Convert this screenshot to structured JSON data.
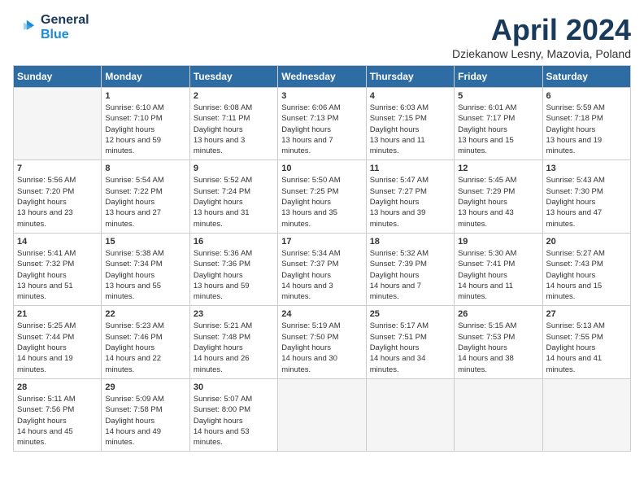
{
  "header": {
    "logo_line1": "General",
    "logo_line2": "Blue",
    "month_title": "April 2024",
    "location": "Dziekanow Lesny, Mazovia, Poland"
  },
  "weekdays": [
    "Sunday",
    "Monday",
    "Tuesday",
    "Wednesday",
    "Thursday",
    "Friday",
    "Saturday"
  ],
  "weeks": [
    [
      {
        "day": "",
        "empty": true
      },
      {
        "day": "1",
        "sunrise": "6:10 AM",
        "sunset": "7:10 PM",
        "daylight": "12 hours and 59 minutes."
      },
      {
        "day": "2",
        "sunrise": "6:08 AM",
        "sunset": "7:11 PM",
        "daylight": "13 hours and 3 minutes."
      },
      {
        "day": "3",
        "sunrise": "6:06 AM",
        "sunset": "7:13 PM",
        "daylight": "13 hours and 7 minutes."
      },
      {
        "day": "4",
        "sunrise": "6:03 AM",
        "sunset": "7:15 PM",
        "daylight": "13 hours and 11 minutes."
      },
      {
        "day": "5",
        "sunrise": "6:01 AM",
        "sunset": "7:17 PM",
        "daylight": "13 hours and 15 minutes."
      },
      {
        "day": "6",
        "sunrise": "5:59 AM",
        "sunset": "7:18 PM",
        "daylight": "13 hours and 19 minutes."
      }
    ],
    [
      {
        "day": "7",
        "sunrise": "5:56 AM",
        "sunset": "7:20 PM",
        "daylight": "13 hours and 23 minutes."
      },
      {
        "day": "8",
        "sunrise": "5:54 AM",
        "sunset": "7:22 PM",
        "daylight": "13 hours and 27 minutes."
      },
      {
        "day": "9",
        "sunrise": "5:52 AM",
        "sunset": "7:24 PM",
        "daylight": "13 hours and 31 minutes."
      },
      {
        "day": "10",
        "sunrise": "5:50 AM",
        "sunset": "7:25 PM",
        "daylight": "13 hours and 35 minutes."
      },
      {
        "day": "11",
        "sunrise": "5:47 AM",
        "sunset": "7:27 PM",
        "daylight": "13 hours and 39 minutes."
      },
      {
        "day": "12",
        "sunrise": "5:45 AM",
        "sunset": "7:29 PM",
        "daylight": "13 hours and 43 minutes."
      },
      {
        "day": "13",
        "sunrise": "5:43 AM",
        "sunset": "7:30 PM",
        "daylight": "13 hours and 47 minutes."
      }
    ],
    [
      {
        "day": "14",
        "sunrise": "5:41 AM",
        "sunset": "7:32 PM",
        "daylight": "13 hours and 51 minutes."
      },
      {
        "day": "15",
        "sunrise": "5:38 AM",
        "sunset": "7:34 PM",
        "daylight": "13 hours and 55 minutes."
      },
      {
        "day": "16",
        "sunrise": "5:36 AM",
        "sunset": "7:36 PM",
        "daylight": "13 hours and 59 minutes."
      },
      {
        "day": "17",
        "sunrise": "5:34 AM",
        "sunset": "7:37 PM",
        "daylight": "14 hours and 3 minutes."
      },
      {
        "day": "18",
        "sunrise": "5:32 AM",
        "sunset": "7:39 PM",
        "daylight": "14 hours and 7 minutes."
      },
      {
        "day": "19",
        "sunrise": "5:30 AM",
        "sunset": "7:41 PM",
        "daylight": "14 hours and 11 minutes."
      },
      {
        "day": "20",
        "sunrise": "5:27 AM",
        "sunset": "7:43 PM",
        "daylight": "14 hours and 15 minutes."
      }
    ],
    [
      {
        "day": "21",
        "sunrise": "5:25 AM",
        "sunset": "7:44 PM",
        "daylight": "14 hours and 19 minutes."
      },
      {
        "day": "22",
        "sunrise": "5:23 AM",
        "sunset": "7:46 PM",
        "daylight": "14 hours and 22 minutes."
      },
      {
        "day": "23",
        "sunrise": "5:21 AM",
        "sunset": "7:48 PM",
        "daylight": "14 hours and 26 minutes."
      },
      {
        "day": "24",
        "sunrise": "5:19 AM",
        "sunset": "7:50 PM",
        "daylight": "14 hours and 30 minutes."
      },
      {
        "day": "25",
        "sunrise": "5:17 AM",
        "sunset": "7:51 PM",
        "daylight": "14 hours and 34 minutes."
      },
      {
        "day": "26",
        "sunrise": "5:15 AM",
        "sunset": "7:53 PM",
        "daylight": "14 hours and 38 minutes."
      },
      {
        "day": "27",
        "sunrise": "5:13 AM",
        "sunset": "7:55 PM",
        "daylight": "14 hours and 41 minutes."
      }
    ],
    [
      {
        "day": "28",
        "sunrise": "5:11 AM",
        "sunset": "7:56 PM",
        "daylight": "14 hours and 45 minutes."
      },
      {
        "day": "29",
        "sunrise": "5:09 AM",
        "sunset": "7:58 PM",
        "daylight": "14 hours and 49 minutes."
      },
      {
        "day": "30",
        "sunrise": "5:07 AM",
        "sunset": "8:00 PM",
        "daylight": "14 hours and 53 minutes."
      },
      {
        "day": "",
        "empty": true
      },
      {
        "day": "",
        "empty": true
      },
      {
        "day": "",
        "empty": true
      },
      {
        "day": "",
        "empty": true
      }
    ]
  ],
  "labels": {
    "sunrise": "Sunrise:",
    "sunset": "Sunset:",
    "daylight": "Daylight hours"
  }
}
